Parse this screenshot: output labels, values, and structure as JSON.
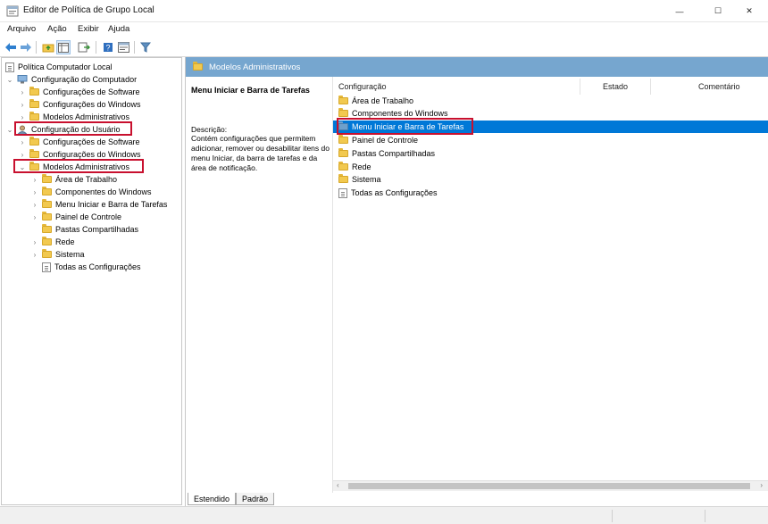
{
  "window": {
    "title": "Editor de Política de Grupo Local",
    "minimize_glyph": "—",
    "maximize_glyph": "☐",
    "close_glyph": "✕"
  },
  "menu": {
    "items": [
      "Arquivo",
      "Ação",
      "Exibir",
      "Ajuda"
    ]
  },
  "toolbar": {
    "icons": [
      "back-arrow-icon",
      "forward-arrow-icon",
      "up-folder-icon",
      "show-hide-tree-icon",
      "export-list-icon",
      "help-icon",
      "properties-icon",
      "filter-icon"
    ]
  },
  "tree": {
    "root": "Política Computador Local",
    "computer_config": "Configuração do Computador",
    "computer_children": [
      "Configurações de Software",
      "Configurações do Windows",
      "Modelos Administrativos"
    ],
    "user_config": "Configuração do Usuário",
    "user_children": [
      "Configurações de Software",
      "Configurações do Windows",
      "Modelos Administrativos"
    ],
    "admin_templates_children": [
      "Área de Trabalho",
      "Componentes do Windows",
      "Menu Iniciar e Barra de Tarefas",
      "Painel de Controle",
      "Pastas Compartilhadas",
      "Rede",
      "Sistema",
      "Todas as Configurações"
    ]
  },
  "right": {
    "header_title": "Modelos Administrativos",
    "selected_title": "Menu Iniciar e Barra de Tarefas",
    "description_label": "Descrição:",
    "description_text": "Contém configurações que permitem adicionar, remover ou desabilitar itens do menu Iniciar, da barra de tarefas e da área de notificação.",
    "columns": [
      "Configuração",
      "Estado",
      "Comentário"
    ],
    "items": [
      "Área de Trabalho",
      "Componentes do Windows",
      "Menu Iniciar e Barra de Tarefas",
      "Painel de Controle",
      "Pastas Compartilhadas",
      "Rede",
      "Sistema",
      "Todas as Configurações"
    ],
    "selected_index": 2
  },
  "tabs": [
    "Estendido",
    "Padrão"
  ],
  "colors": {
    "accent": "#0078d7",
    "header_blue": "#76a6cf",
    "highlight_red": "#c8102e",
    "folder_yellow": "#f2c94f"
  }
}
